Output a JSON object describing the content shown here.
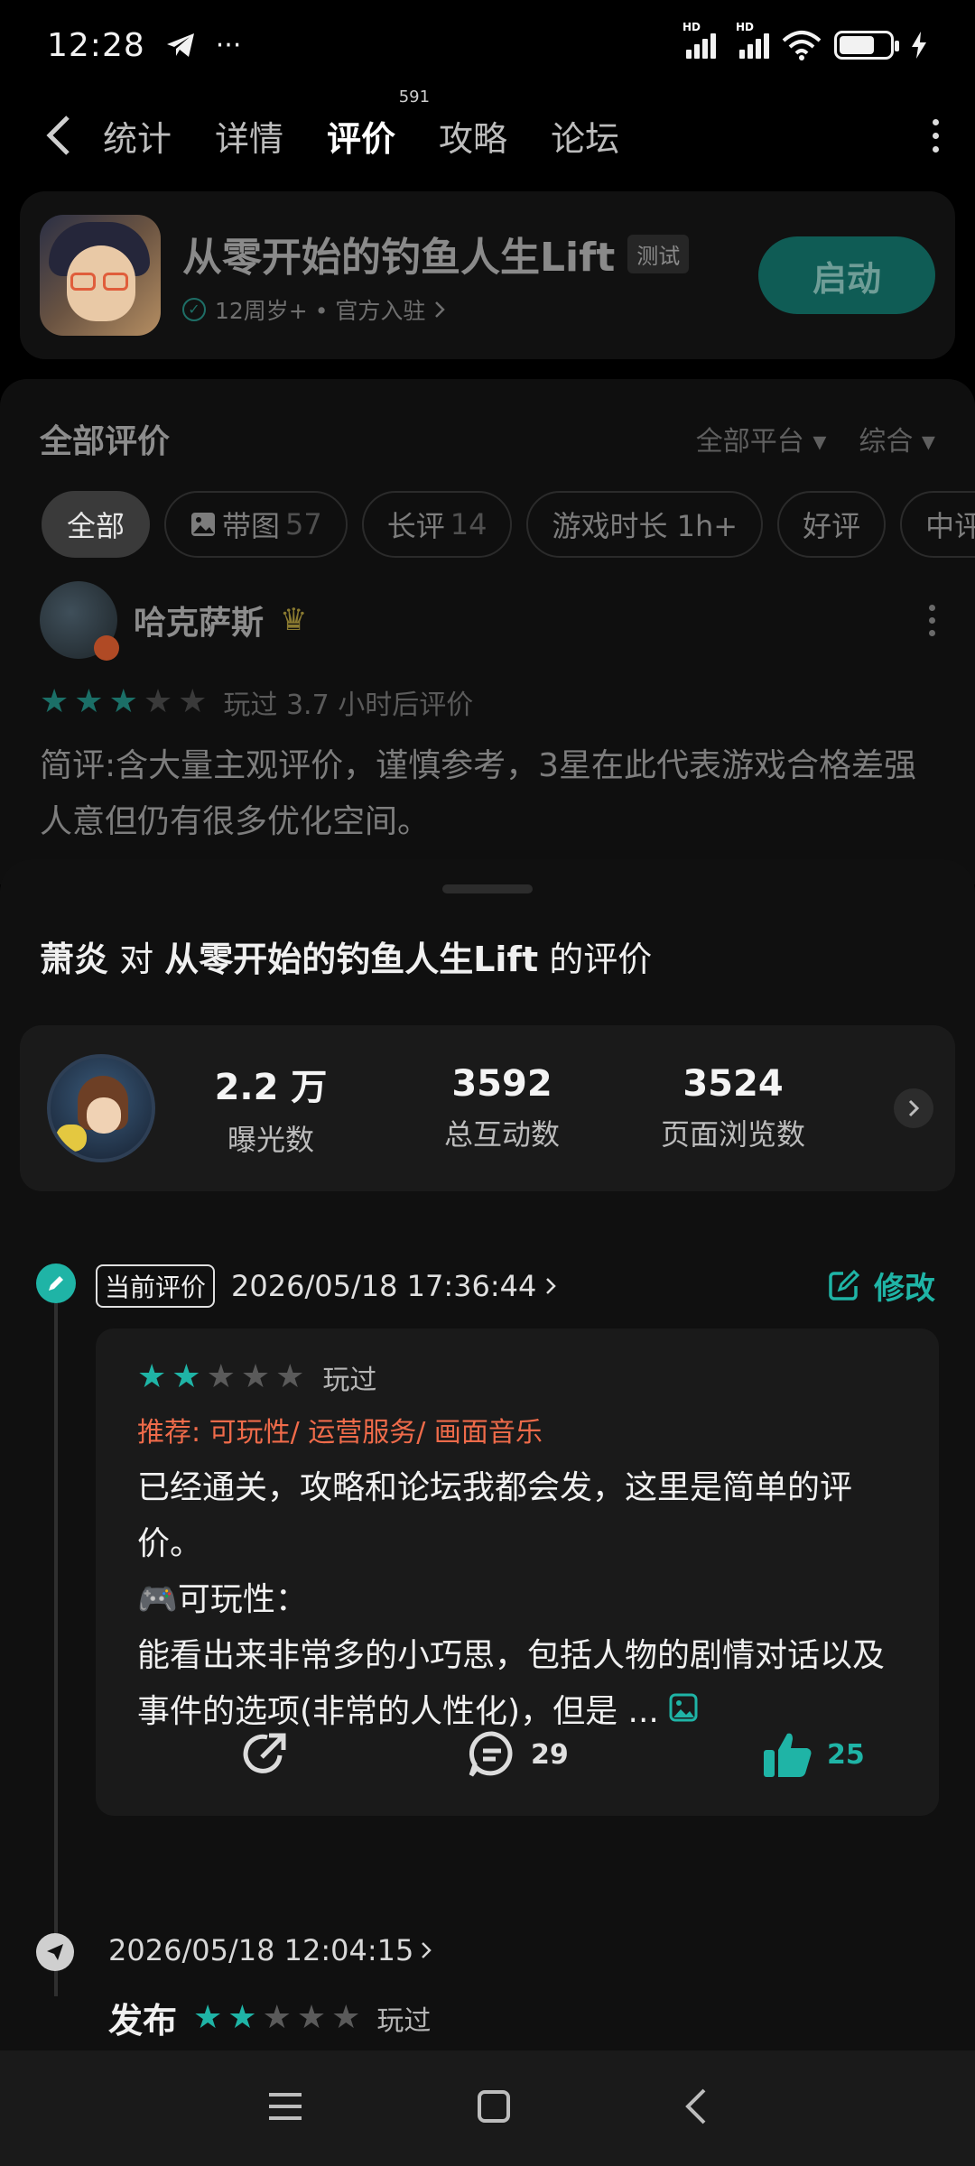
{
  "status_bar": {
    "time": "12:28",
    "more": "···"
  },
  "tabs": [
    {
      "label": "统计"
    },
    {
      "label": "详情"
    },
    {
      "label": "评价",
      "badge": "591",
      "active": true
    },
    {
      "label": "攻略"
    },
    {
      "label": "论坛"
    }
  ],
  "app": {
    "name": "从零开始的钓鱼人生Lift",
    "tag": "测试",
    "sub": "12周岁+ • 官方入驻",
    "launch_label": "启动"
  },
  "list": {
    "title": "全部评价",
    "filter_platform": "全部平台",
    "filter_sort": "综合",
    "chips": [
      {
        "label": "全部",
        "count": "",
        "active": true
      },
      {
        "label": "带图",
        "count": "57"
      },
      {
        "label": "长评",
        "count": "14"
      },
      {
        "label": "游戏时长 1h+",
        "count": ""
      },
      {
        "label": "好评",
        "count": ""
      },
      {
        "label": "中评",
        "count": ""
      }
    ],
    "review": {
      "user": "哈克萨斯",
      "rating": 3,
      "meta": "玩过 3.7 小时后评价",
      "text": "简评:含大量主观评价，谨慎参考，3星在此代表游戏合格差强人意但仍有很多优化空间。"
    }
  },
  "sheet": {
    "title_user": "萧炎",
    "title_mid": " 对 ",
    "title_app": "从零开始的钓鱼人生Lift",
    "title_end": " 的评价",
    "stats": [
      {
        "value": "2.2 万",
        "label": "曝光数"
      },
      {
        "value": "3592",
        "label": "总互动数"
      },
      {
        "value": "3524",
        "label": "页面浏览数"
      }
    ],
    "current": {
      "tag": "当前评价",
      "date": "2026/05/18 17:36:44",
      "edit_label": "修改",
      "rating": 2,
      "played": "玩过",
      "recommend": "推荐: 可玩性/ 运营服务/ 画面音乐",
      "body_line1": "已经通关，攻略和论坛我都会发，这里是简单的评价。",
      "body_line2": "🎮可玩性：",
      "body_line3": "能看出来非常多的小巧思，包括人物的剧情对话以及事件的选项(非常的人性化)，但是 ...",
      "comments": "29",
      "likes": "25"
    },
    "publish": {
      "date": "2026/05/18 12:04:15",
      "label": "发布",
      "rating": 2,
      "played": "玩过"
    }
  },
  "colors": {
    "accent": "#1fb4a6",
    "recommend": "#ef6b4a"
  }
}
